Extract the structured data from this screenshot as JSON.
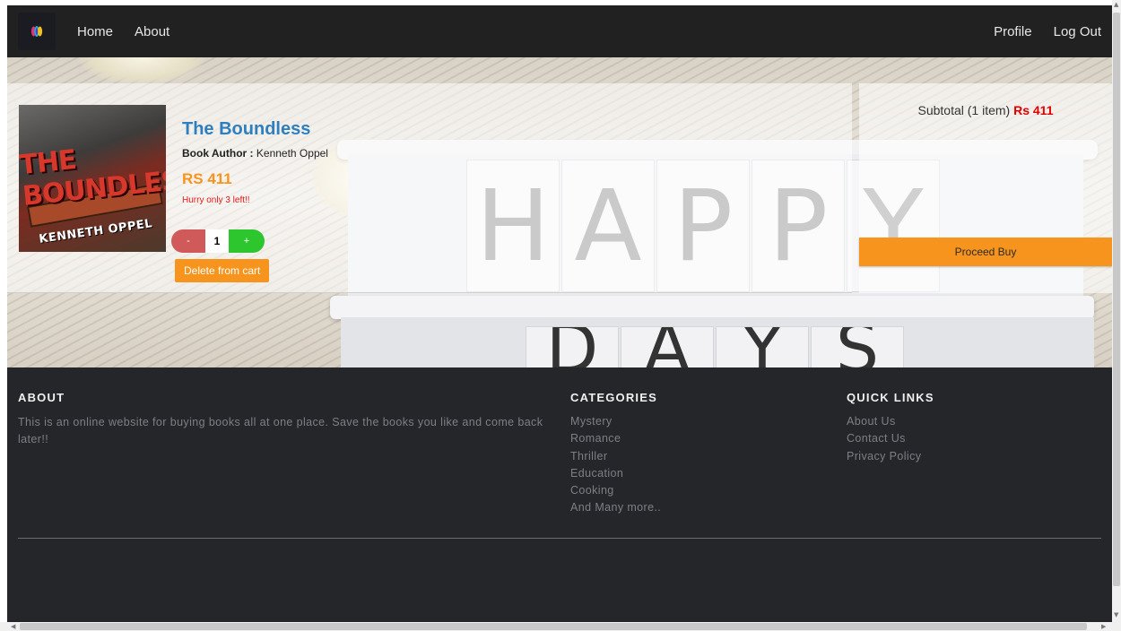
{
  "navbar": {
    "logo_icon": "bookstore-logo-icon",
    "left_links": [
      "Home",
      "About"
    ],
    "right_links": [
      "Profile",
      "Log Out"
    ]
  },
  "hero": {
    "letterboard_row1": [
      "H",
      "A",
      "P",
      "P",
      "Y"
    ],
    "letterboard_row2": [
      "D",
      "A",
      "Y",
      "S"
    ]
  },
  "cart": {
    "item": {
      "title": "The Boundless",
      "author_label": "Book Author :",
      "author": "Kenneth Oppel",
      "price": "RS 411",
      "stock_note": "Hurry only 3 left!!",
      "quantity": "1",
      "minus_label": "-",
      "plus_label": "+",
      "delete_label": "Delete from cart",
      "cover_title": "THE BOUNDLESS",
      "cover_author": "KENNETH OPPEL"
    },
    "summary": {
      "subtotal_label": "Subtotal (1 item)",
      "subtotal_amount": "Rs 411",
      "proceed_label": "Proceed Buy"
    }
  },
  "footer": {
    "about": {
      "heading": "ABOUT",
      "text": "This is an online website for buying books all at one place. Save the books you like and come back later!!"
    },
    "categories": {
      "heading": "CATEGORIES",
      "items": [
        "Mystery",
        "Romance",
        "Thriller",
        "Education",
        "Cooking",
        "And Many more.."
      ]
    },
    "quick_links": {
      "heading": "QUICK LINKS",
      "items": [
        "About Us",
        "Contact Us",
        "Privacy Policy"
      ]
    }
  },
  "colors": {
    "navbar_bg": "#212121",
    "footer_bg": "#25262a",
    "accent_orange": "#f7941d",
    "title_blue": "#2f7fbf",
    "alert_red": "#e61a1a",
    "plus_green": "#2ec62e",
    "minus_red": "#d05a5a"
  }
}
